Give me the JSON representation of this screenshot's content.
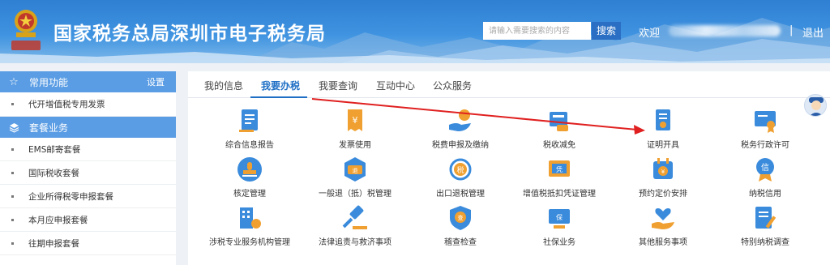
{
  "header": {
    "title": "国家税务总局深圳市电子税务局",
    "search_placeholder": "请输入需要搜索的内容",
    "search_button": "搜索",
    "welcome": "欢迎",
    "separator": "|",
    "logout": "退出",
    "brand_color": "#3a8bdc"
  },
  "sidebar": {
    "common": {
      "label": "常用功能",
      "settings": "设置",
      "icon": "star-icon"
    },
    "common_items": [
      {
        "label": "代开增值税专用发票"
      }
    ],
    "package": {
      "label": "套餐业务",
      "icon": "layers-icon"
    },
    "package_items": [
      {
        "label": "EMS邮寄套餐"
      },
      {
        "label": "国际税收套餐"
      },
      {
        "label": "企业所得税零申报套餐"
      },
      {
        "label": "本月应申报套餐"
      },
      {
        "label": "往期申报套餐"
      }
    ]
  },
  "tabs": [
    {
      "label": "我的信息",
      "active": false
    },
    {
      "label": "我要办税",
      "active": true
    },
    {
      "label": "我要查询",
      "active": false
    },
    {
      "label": "互动中心",
      "active": false
    },
    {
      "label": "公众服务",
      "active": false
    }
  ],
  "services": [
    {
      "label": "综合信息报告",
      "icon": "report-icon"
    },
    {
      "label": "发票使用",
      "icon": "invoice-icon"
    },
    {
      "label": "税费申报及缴纳",
      "icon": "tax-payment-icon"
    },
    {
      "label": "税收减免",
      "icon": "tax-reduction-icon"
    },
    {
      "label": "证明开具",
      "icon": "certificate-icon"
    },
    {
      "label": "税务行政许可",
      "icon": "license-icon"
    },
    {
      "label": "核定管理",
      "icon": "stamp-icon"
    },
    {
      "label": "一般退（抵）税管理",
      "icon": "refund-icon"
    },
    {
      "label": "出口退税管理",
      "icon": "export-refund-icon"
    },
    {
      "label": "增值税抵扣凭证管理",
      "icon": "voucher-icon"
    },
    {
      "label": "预约定价安排",
      "icon": "pricing-icon"
    },
    {
      "label": "纳税信用",
      "icon": "credit-icon"
    },
    {
      "label": "涉税专业服务机构管理",
      "icon": "agency-icon"
    },
    {
      "label": "法律追责与救济事项",
      "icon": "gavel-icon"
    },
    {
      "label": "稽查检查",
      "icon": "inspection-icon"
    },
    {
      "label": "社保业务",
      "icon": "social-security-icon"
    },
    {
      "label": "其他服务事项",
      "icon": "heart-hand-icon"
    },
    {
      "label": "特别纳税调查",
      "icon": "special-investigation-icon"
    }
  ],
  "annotation_arrow_color": "#e02020"
}
